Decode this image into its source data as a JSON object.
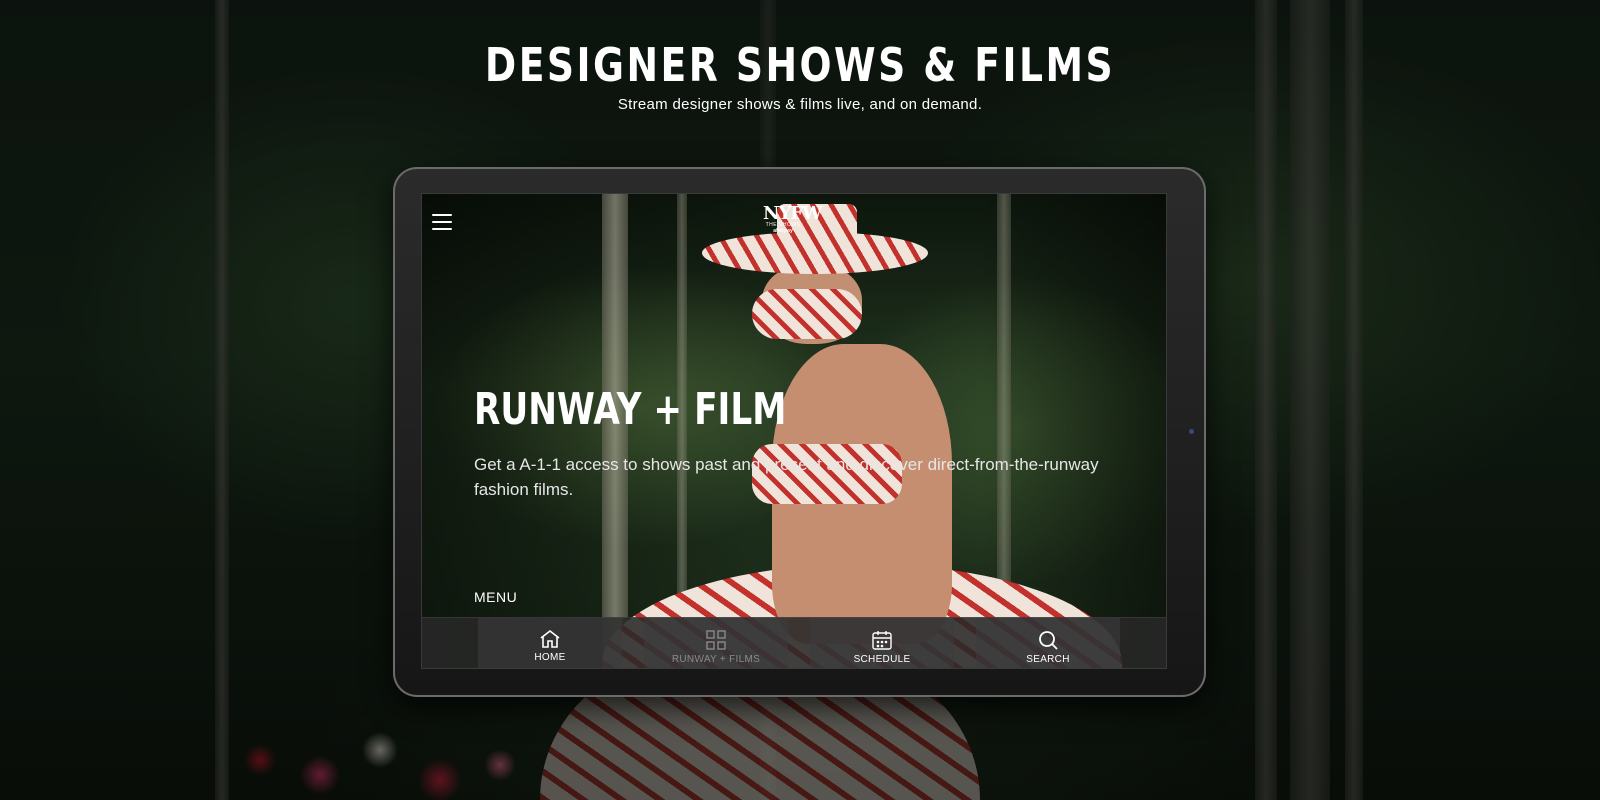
{
  "hero": {
    "title": "DESIGNER SHOWS & FILMS",
    "subtitle": "Stream designer shows & films live, and on demand."
  },
  "app": {
    "logo": {
      "main": "NYFW",
      "sub": "THE SHOWS",
      "partner": "afterpay"
    },
    "headline": "RUNWAY + FILM",
    "description": "Get a A-1-1 access to shows past and present and discover direct-from-the-runway fashion films.",
    "menu_label": "MENU",
    "nav": [
      {
        "label": "HOME",
        "icon": "home-icon",
        "active": false
      },
      {
        "label": "RUNWAY + FILMS",
        "icon": "grid-icon",
        "active": true
      },
      {
        "label": "SCHEDULE",
        "icon": "calendar-icon",
        "active": false
      },
      {
        "label": "SEARCH",
        "icon": "search-icon",
        "active": false
      }
    ]
  },
  "colors": {
    "accent_red": "#c3312c",
    "text": "#ffffff",
    "nav_inactive": "#8a8a8a"
  }
}
